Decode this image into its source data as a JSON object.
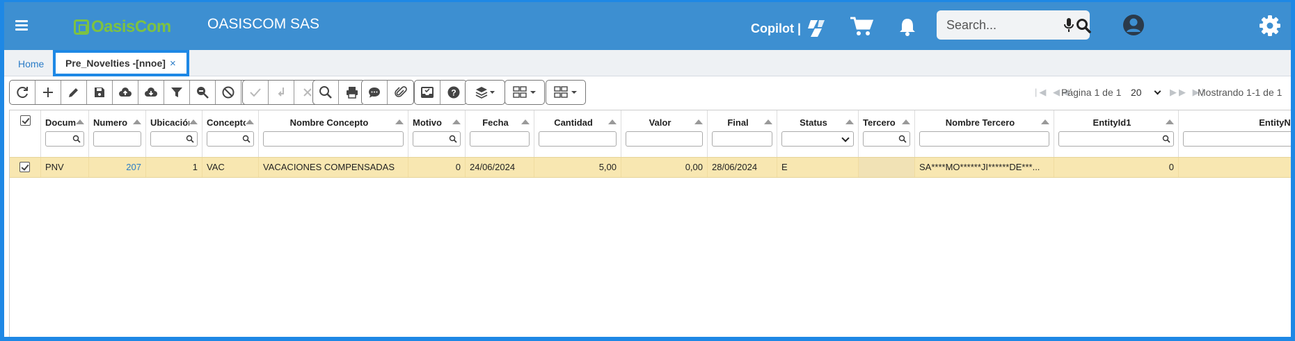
{
  "header": {
    "logo_text": "OasisCom",
    "company": "OASISCOM SAS",
    "copilot_label": "Copilot |",
    "search_placeholder": "Search..."
  },
  "tabs": {
    "home": "Home",
    "active": "Pre_Novelties -[nnoe]",
    "close": "×"
  },
  "pager": {
    "page_text": "Página 1 de 1",
    "page_size": "20",
    "showing": "Mostrando 1-1 de 1"
  },
  "grid": {
    "columns": [
      "Documento",
      "Numero",
      "Ubicación",
      "Concepto",
      "Nombre Concepto",
      "Motivo",
      "Fecha",
      "Cantidad",
      "Valor",
      "Final",
      "Status",
      "Tercero",
      "Nombre Tercero",
      "EntityId1",
      "EntityNa"
    ],
    "row": {
      "documento": "PNV",
      "numero": "207",
      "ubicacion": "1",
      "concepto": "VAC",
      "nombre_concepto": "VACACIONES COMPENSADAS",
      "motivo": "0",
      "fecha": "24/06/2024",
      "cantidad": "5,00",
      "valor": "0,00",
      "final": "28/06/2024",
      "status": "E",
      "tercero": "",
      "nombre_tercero": "SA****MO******JI******DE***...",
      "entityid1": "0"
    }
  },
  "colors": {
    "topbar": "#3d8fd1",
    "highlight": "#1e88e5",
    "selected_row": "#f8e7b1",
    "logo_green": "#7dc242"
  }
}
